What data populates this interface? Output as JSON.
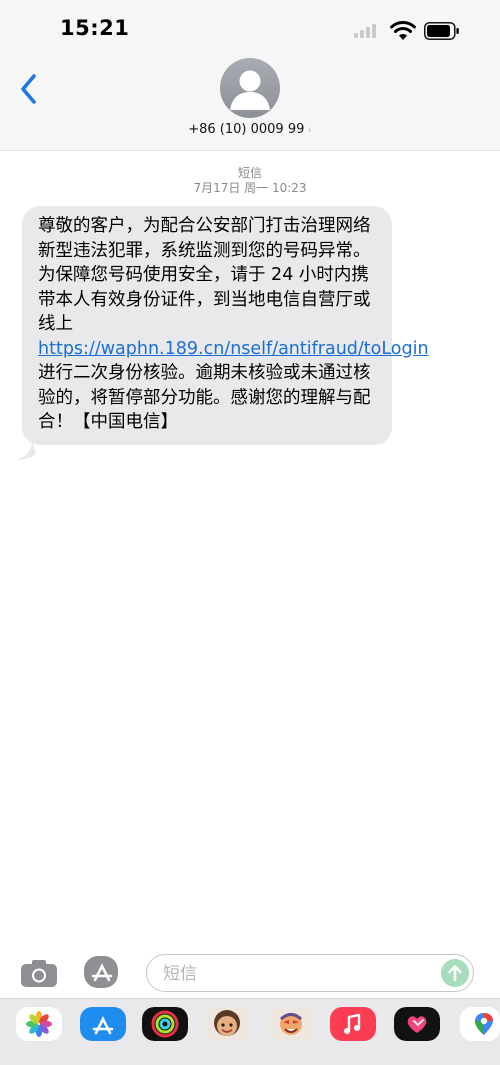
{
  "status_bar": {
    "time": "15:21"
  },
  "header": {
    "contact": "+86 (10) 0009 99",
    "contact_chevron": "›"
  },
  "thread": {
    "service_label": "短信",
    "timestamp": "7月17日 周一 10:23",
    "message": {
      "text_before_link": "尊敬的客户，为配合公安部门打击治理网络新型违法犯罪，系统监测到您的号码异常。为保障您号码使用安全，请于 24 小时内携带本人有效身份证件，到当地电信自营厅或线上 ",
      "link_text": "https://waphn.189.cn/nself/antifraud/toLogin",
      "text_after_link": " 进行二次身份核验。逾期未核验或未通过核验的，将暂停部分功能。感谢您的理解与配合！【中国电信】"
    }
  },
  "compose": {
    "placeholder": "短信",
    "value": ""
  },
  "drawer": {
    "apps": [
      "photos-app",
      "app-store-app",
      "fitness-app",
      "memoji-app",
      "memoji-stickers-app",
      "music-app",
      "digital-touch-app",
      "maps-app"
    ]
  },
  "colors": {
    "link": "#1a6ed8",
    "bubble": "#e9e9eb",
    "back": "#1a78e6",
    "send": "#a9dcbc"
  }
}
